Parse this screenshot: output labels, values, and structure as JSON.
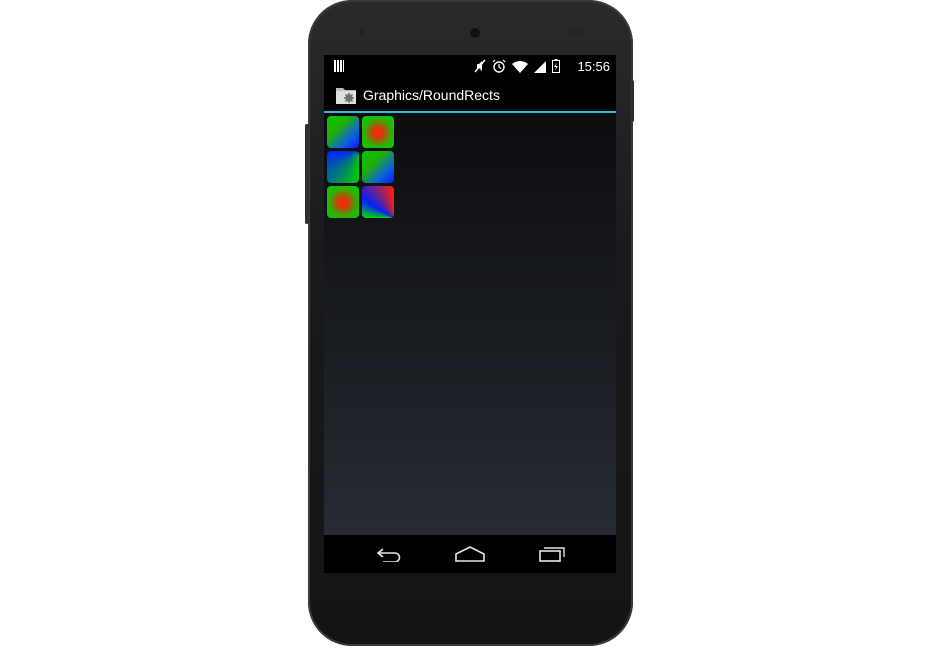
{
  "status_bar": {
    "time": "15:56",
    "icons": [
      "notification-icon",
      "mute-icon",
      "alarm-icon",
      "wifi-icon",
      "signal-icon",
      "battery-icon"
    ]
  },
  "action_bar": {
    "title": "Graphics/RoundRects",
    "app_icon": "folder-gear-icon",
    "accent_color": "#33b5e5"
  },
  "round_rects": [
    {
      "shader": "linear-gradient",
      "colors": [
        "#00cc00",
        "#0022ff"
      ]
    },
    {
      "shader": "radial-gradient",
      "colors": [
        "#ff2a00",
        "#00d000"
      ]
    },
    {
      "shader": "sweep-gradient",
      "colors": [
        "#ff3000",
        "#00cc00",
        "#0022ff"
      ]
    },
    {
      "shader": "linear-gradient",
      "colors": [
        "#00cc00",
        "#0022ff"
      ]
    },
    {
      "shader": "radial-gradient",
      "colors": [
        "#ff2a00",
        "#00d000"
      ]
    },
    {
      "shader": "sweep-gradient",
      "colors": [
        "#00dd00",
        "#0022ff",
        "#ff2200"
      ]
    }
  ],
  "nav_bar": {
    "buttons": [
      "back-icon",
      "home-icon",
      "recent-apps-icon"
    ]
  }
}
